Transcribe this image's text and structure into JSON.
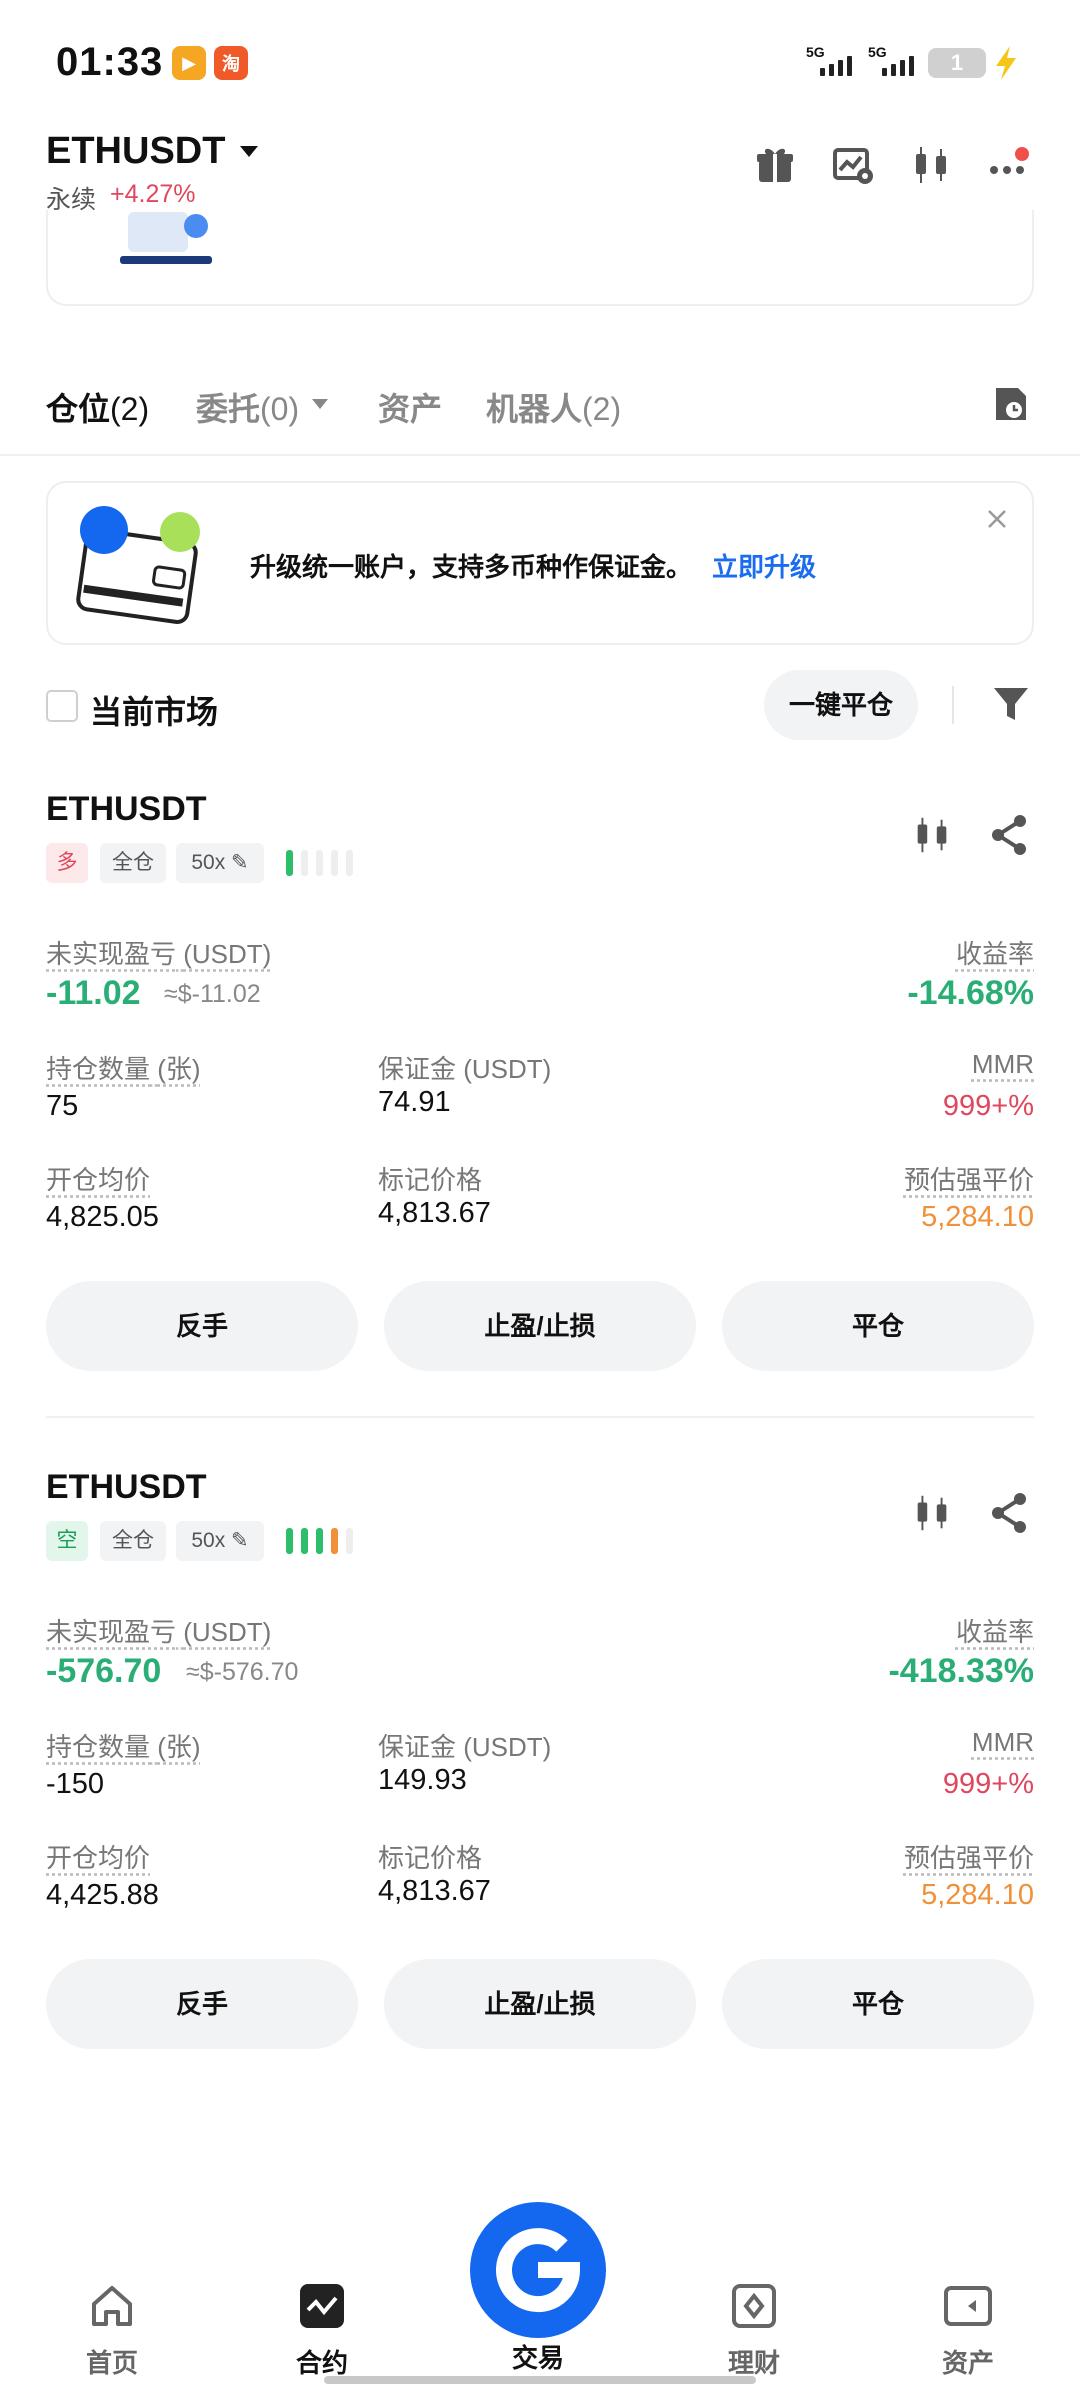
{
  "status_bar": {
    "time": "01:33",
    "app_icon_1": "video-app-icon",
    "app_icon_2_text": "淘",
    "signal_1": "5G",
    "signal_2": "5G",
    "battery": "1"
  },
  "header": {
    "pair": "ETHUSDT",
    "type": "永续",
    "change": "+4.27%",
    "change_color": "#e0475e",
    "icons": [
      "gift-icon",
      "chart-settings-icon",
      "candlestick-icon",
      "more-icon"
    ]
  },
  "tabs": [
    {
      "label": "仓位",
      "count": "(2)"
    },
    {
      "label": "委托",
      "count": "(0)"
    },
    {
      "label": "资产",
      "count": ""
    },
    {
      "label": "机器人",
      "count": "(2)"
    }
  ],
  "upgrade_banner": {
    "text": "升级统一账户，支持多币种作保证金。",
    "link": "立即升级"
  },
  "filter": {
    "current_market": "当前市场",
    "close_all": "一键平仓"
  },
  "labels": {
    "unrealized_pnl": "未实现盈亏",
    "usdt_unit": "(USDT)",
    "roe": "收益率",
    "qty": "持仓数量",
    "qty_unit": "(张)",
    "margin": "保证金",
    "mmr": "MMR",
    "entry_price": "开仓均价",
    "mark_price": "标记价格",
    "liq_price": "预估强平价"
  },
  "positions": [
    {
      "symbol": "ETHUSDT",
      "side": "多",
      "mode": "全仓",
      "leverage": "50x",
      "risk_level": 0.2,
      "pnl": "-11.02",
      "pnl_usd": "≈$-11.02",
      "roe": "-14.68%",
      "qty": "75",
      "margin": "74.91",
      "mmr": "999+%",
      "entry": "4,825.05",
      "mark": "4,813.67",
      "liq": "5,284.10",
      "actions": [
        "反手",
        "止盈/止损",
        "平仓"
      ]
    },
    {
      "symbol": "ETHUSDT",
      "side": "空",
      "mode": "全仓",
      "leverage": "50x",
      "risk_level": 0.8,
      "pnl": "-576.70",
      "pnl_usd": "≈$-576.70",
      "roe": "-418.33%",
      "qty": "-150",
      "margin": "149.93",
      "mmr": "999+%",
      "entry": "4,425.88",
      "mark": "4,813.67",
      "liq": "5,284.10",
      "actions": [
        "反手",
        "止盈/止损",
        "平仓"
      ]
    }
  ],
  "bottom_nav": [
    {
      "label": "首页",
      "icon": "home-icon"
    },
    {
      "label": "合约",
      "icon": "futures-icon"
    },
    {
      "label": "交易",
      "icon": "trade-icon"
    },
    {
      "label": "理财",
      "icon": "earn-icon"
    },
    {
      "label": "资产",
      "icon": "wallet-icon"
    }
  ],
  "colors": {
    "profit_green": "#2aae76",
    "loss_red": "#e0475e",
    "liq_orange": "#f0913a",
    "accent_blue": "#1468f0"
  }
}
